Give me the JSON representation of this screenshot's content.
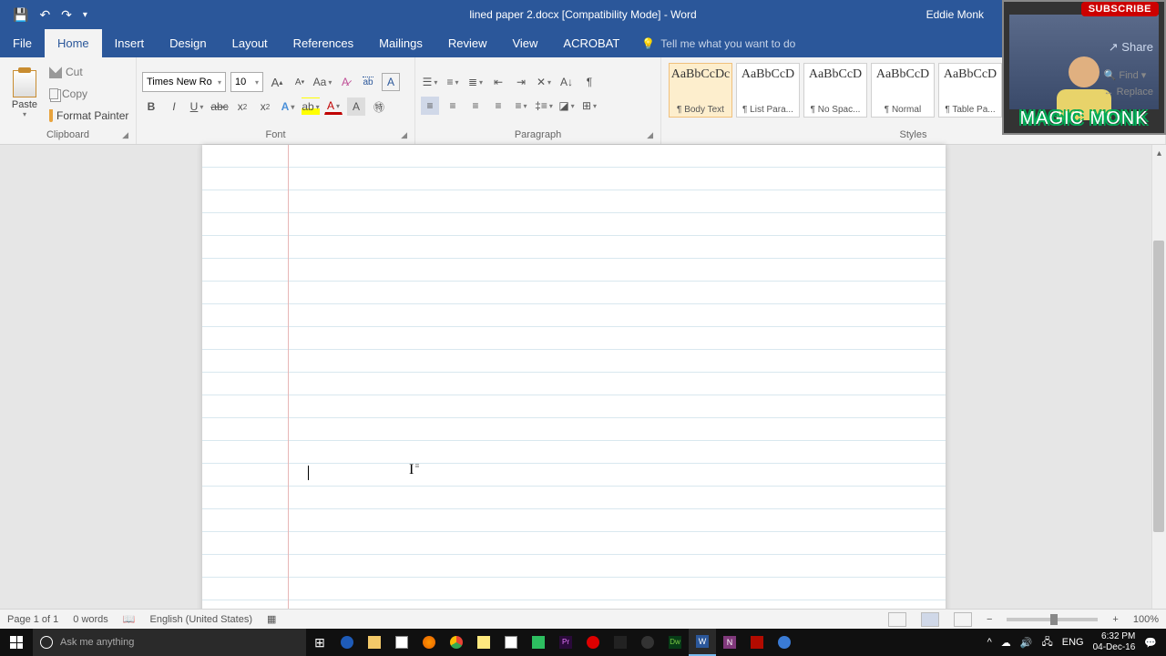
{
  "titlebar": {
    "title": "lined paper 2.docx [Compatibility Mode] - Word",
    "user": "Eddie Monk"
  },
  "tabs": {
    "file": "File",
    "items": [
      "Home",
      "Insert",
      "Design",
      "Layout",
      "References",
      "Mailings",
      "Review",
      "View",
      "ACROBAT"
    ],
    "active": "Home",
    "tellme": "Tell me what you want to do"
  },
  "ribbon": {
    "clipboard": {
      "label": "Clipboard",
      "paste": "Paste",
      "cut": "Cut",
      "copy": "Copy",
      "format_painter": "Format Painter"
    },
    "font": {
      "label": "Font",
      "name": "Times New Ro",
      "size": "10"
    },
    "paragraph": {
      "label": "Paragraph"
    },
    "styles": {
      "label": "Styles",
      "items": [
        {
          "preview": "AaBbCcDc",
          "name": "¶ Body Text"
        },
        {
          "preview": "AaBbCcD",
          "name": "¶ List Para..."
        },
        {
          "preview": "AaBbCcD",
          "name": "¶ No Spac..."
        },
        {
          "preview": "AaBbCcD",
          "name": "¶ Normal"
        },
        {
          "preview": "AaBbCcD",
          "name": "¶ Table Pa..."
        }
      ]
    },
    "editing": {
      "find": "Find",
      "replace": "Replace"
    },
    "share": "Share"
  },
  "status": {
    "page": "Page 1 of 1",
    "words": "0 words",
    "lang": "English (United States)",
    "zoom": "100%"
  },
  "taskbar": {
    "cortana": "Ask me anything",
    "lang": "ENG",
    "time": "6:32 PM",
    "date": "04-Dec-16"
  },
  "overlay": {
    "subscribe": "SUBSCRIBE",
    "brand": "MAGIC MONK"
  }
}
